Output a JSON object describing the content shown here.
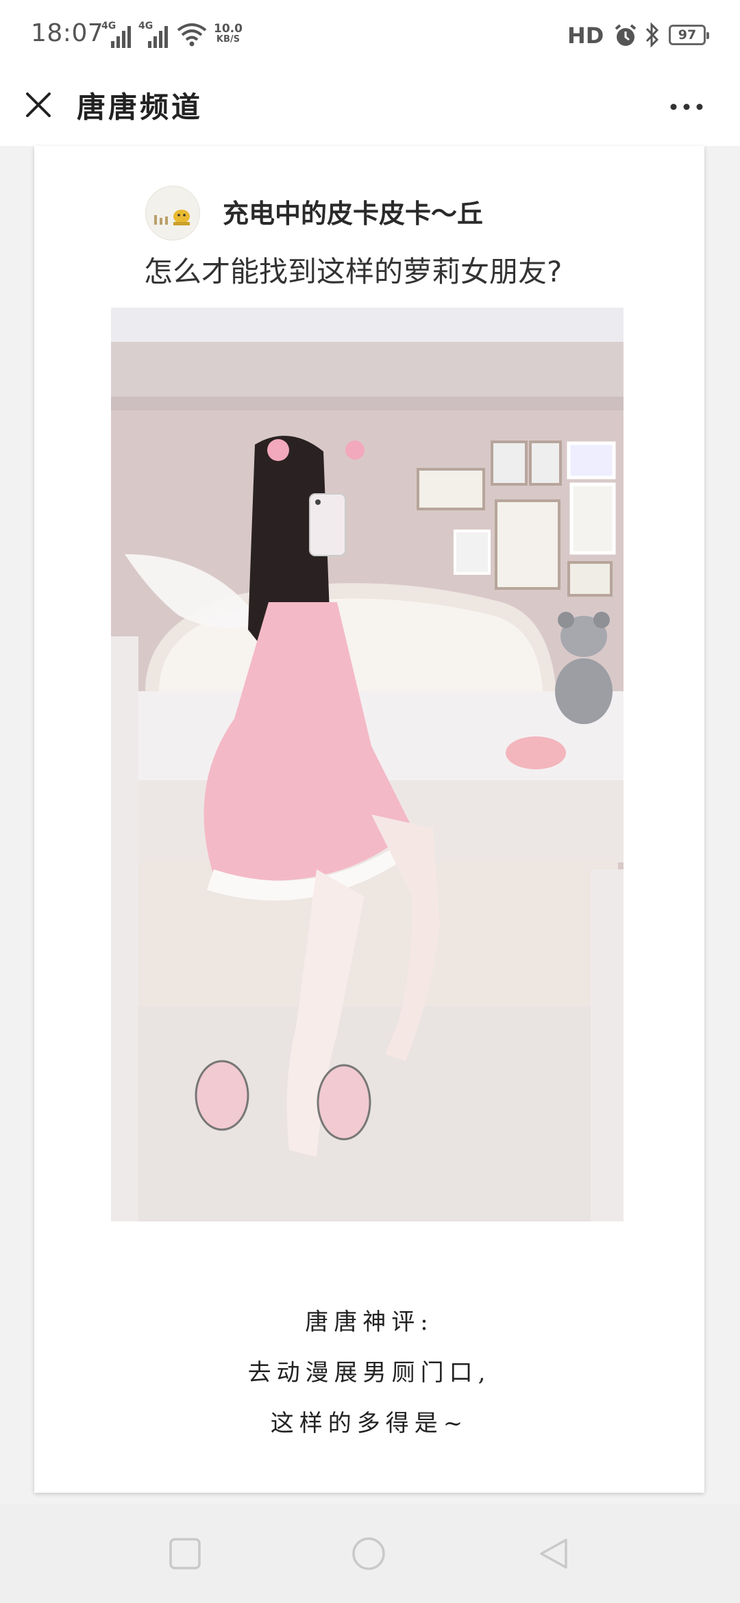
{
  "status_bar": {
    "time": "18:07",
    "network_1": "4G",
    "network_2": "4G",
    "speed_value": "10.0",
    "speed_unit": "KB/S",
    "hd_label": "HD",
    "battery": "97"
  },
  "title_bar": {
    "title": "唐唐频道",
    "close_icon": "close-icon",
    "more_icon": "more-icon"
  },
  "post": {
    "username": "充电中的皮卡皮卡～丘",
    "question": "怎么才能找到这样的萝莉女朋友?"
  },
  "caption": {
    "line1": "唐唐神评:",
    "line2": "去动漫展男厕门口,",
    "line3": "这样的多得是~"
  },
  "nav": {
    "square": "recent-apps-icon",
    "circle": "home-icon",
    "triangle": "back-icon"
  },
  "colors": {
    "status_text": "#555555",
    "nav_icon": "#c9c9c9",
    "card_bg": "#ffffff",
    "page_bg": "#f2f2f2"
  }
}
